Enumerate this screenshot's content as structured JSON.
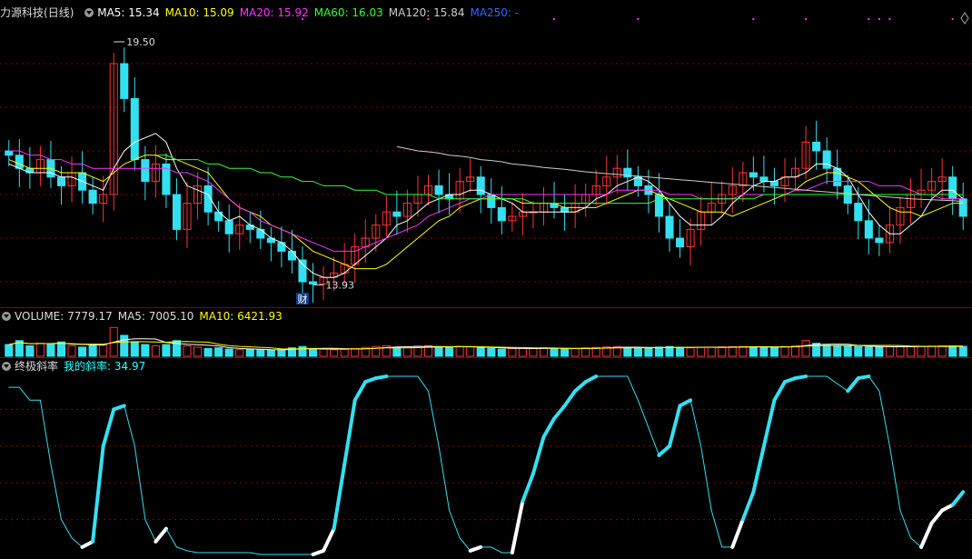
{
  "price_panel": {
    "stock_name": "力源科技",
    "period": "(日线)",
    "indicators": [
      {
        "text": "MA5: 15.34",
        "color": "#ffffff"
      },
      {
        "text": "MA10: 15.09",
        "color": "#ffff00"
      },
      {
        "text": "MA20: 15.92",
        "color": "#ff33ff"
      },
      {
        "text": "MA60: 16.03",
        "color": "#33ff33"
      },
      {
        "text": "MA120: 15.84",
        "color": "#cccccc"
      },
      {
        "text": "MA250: -",
        "color": "#3366ff"
      }
    ],
    "high_label": "19.50",
    "low_label": "13.93",
    "event_marker": "财"
  },
  "volume_panel": {
    "indicators": [
      {
        "text": "VOLUME: 7779.17",
        "color": "#dddddd"
      },
      {
        "text": "MA5: 7005.10",
        "color": "#dddddd"
      },
      {
        "text": "MA10: 6421.93",
        "color": "#ffff00"
      }
    ]
  },
  "indicator_panel": {
    "name": "终极斜率",
    "value_text": "我的斜率: 34.97",
    "value_color": "#33ffff"
  },
  "colors": {
    "up": "#ff3333",
    "down": "#33e0f0",
    "ma5": "#ffffff",
    "ma10": "#ffff00",
    "ma20": "#ff33ff",
    "ma60": "#33ff33",
    "ma120": "#cccccc",
    "grid": "#8b0000"
  },
  "chart_data": [
    {
      "type": "candlestick",
      "ylim": [
        13.5,
        20.0
      ],
      "high": 19.5,
      "low": 13.93,
      "closes": [
        16.9,
        16.6,
        16.5,
        16.8,
        16.4,
        16.2,
        16.5,
        16.1,
        15.8,
        16.0,
        19.0,
        18.2,
        16.8,
        16.3,
        16.7,
        16.0,
        15.2,
        15.8,
        16.2,
        15.6,
        15.4,
        15.1,
        15.3,
        15.2,
        15.0,
        14.9,
        14.7,
        14.5,
        14.0,
        13.95,
        14.1,
        14.2,
        14.4,
        14.8,
        15.0,
        15.3,
        15.6,
        15.5,
        15.8,
        16.0,
        16.2,
        16.0,
        15.9,
        16.3,
        16.4,
        16.0,
        15.7,
        15.4,
        15.5,
        15.6,
        15.6,
        15.8,
        15.7,
        15.6,
        15.8,
        16.0,
        16.2,
        16.4,
        16.6,
        16.4,
        16.2,
        16.0,
        15.5,
        15.0,
        14.8,
        15.2,
        15.6,
        15.8,
        16.0,
        16.2,
        16.5,
        16.4,
        16.3,
        16.2,
        16.4,
        16.6,
        17.2,
        17.0,
        16.6,
        16.2,
        15.8,
        15.4,
        15.0,
        14.9,
        15.3,
        15.7,
        16.0,
        16.1,
        16.3,
        16.4,
        15.9,
        15.5
      ],
      "series": [
        {
          "name": "MA5",
          "values": [
            16.7,
            16.6,
            16.5,
            16.5,
            16.5,
            16.4,
            16.4,
            16.3,
            16.2,
            16.1,
            16.6,
            17.0,
            17.2,
            17.3,
            17.4,
            17.2,
            16.6,
            16.2,
            16.1,
            16.0,
            15.6,
            15.4,
            15.5,
            15.3,
            15.2,
            15.0,
            14.9,
            14.7,
            14.4,
            14.2,
            14.1,
            14.1,
            14.2,
            14.4,
            14.6,
            14.8,
            15.0,
            15.3,
            15.4,
            15.6,
            15.8,
            15.9,
            16.0,
            16.0,
            16.1,
            16.1,
            16.0,
            15.9,
            15.8,
            15.6,
            15.6,
            15.6,
            15.6,
            15.6,
            15.6,
            15.7,
            15.9,
            16.0,
            16.2,
            16.3,
            16.4,
            16.3,
            16.1,
            15.8,
            15.5,
            15.3,
            15.3,
            15.3,
            15.5,
            15.8,
            16.0,
            16.2,
            16.3,
            16.3,
            16.4,
            16.4,
            16.5,
            16.7,
            16.7,
            16.6,
            16.4,
            16.0,
            15.6,
            15.3,
            15.1,
            15.1,
            15.3,
            15.5,
            15.9,
            16.1,
            16.1,
            15.9
          ]
        },
        {
          "name": "MA10",
          "values": [
            16.8,
            16.7,
            16.6,
            16.6,
            16.6,
            16.5,
            16.5,
            16.5,
            16.4,
            16.3,
            16.5,
            16.7,
            16.8,
            16.9,
            16.9,
            16.8,
            16.8,
            16.7,
            16.6,
            16.5,
            16.2,
            15.9,
            15.7,
            15.6,
            15.5,
            15.3,
            15.2,
            15.1,
            14.9,
            14.7,
            14.6,
            14.5,
            14.4,
            14.3,
            14.3,
            14.3,
            14.4,
            14.6,
            14.8,
            15.0,
            15.2,
            15.4,
            15.5,
            15.7,
            15.8,
            15.9,
            15.9,
            15.9,
            15.9,
            15.8,
            15.8,
            15.8,
            15.8,
            15.7,
            15.7,
            15.7,
            15.7,
            15.8,
            15.9,
            16.0,
            16.1,
            16.1,
            16.0,
            15.9,
            15.8,
            15.7,
            15.6,
            15.6,
            15.6,
            15.5,
            15.6,
            15.7,
            15.8,
            15.9,
            16.0,
            16.1,
            16.3,
            16.4,
            16.5,
            16.5,
            16.4,
            16.3,
            16.1,
            15.9,
            15.7,
            15.6,
            15.6,
            15.5,
            15.6,
            15.7,
            15.8,
            15.8
          ]
        },
        {
          "name": "MA20",
          "values": [
            17.0,
            17.0,
            16.9,
            16.9,
            16.8,
            16.8,
            16.7,
            16.7,
            16.6,
            16.6,
            16.6,
            16.6,
            16.6,
            16.6,
            16.6,
            16.6,
            16.5,
            16.5,
            16.4,
            16.3,
            16.1,
            15.9,
            15.7,
            15.6,
            15.4,
            15.3,
            15.2,
            15.1,
            15.0,
            14.9,
            14.8,
            14.7,
            14.7,
            14.7,
            14.8,
            14.9,
            15.0,
            15.1,
            15.2,
            15.3,
            15.5,
            15.6,
            15.7,
            15.8,
            15.9,
            15.9,
            16.0,
            16.0,
            16.0,
            16.0,
            16.0,
            16.0,
            16.0,
            16.0,
            16.0,
            16.0,
            16.0,
            16.0,
            16.1,
            16.1,
            16.1,
            16.1,
            16.1,
            16.0,
            16.0,
            16.0,
            15.9,
            15.9,
            15.9,
            15.9,
            16.0,
            16.0,
            16.0,
            16.0,
            16.0,
            16.1,
            16.1,
            16.2,
            16.3,
            16.3,
            16.3,
            16.3,
            16.3,
            16.2,
            16.2,
            16.2,
            16.1,
            16.0,
            16.0,
            15.9,
            15.9,
            15.9
          ]
        },
        {
          "name": "MA60",
          "values": [
            null,
            null,
            null,
            null,
            null,
            null,
            null,
            null,
            null,
            null,
            null,
            null,
            null,
            null,
            16.9,
            16.9,
            16.8,
            16.8,
            16.8,
            16.7,
            16.7,
            16.6,
            16.6,
            16.6,
            16.5,
            16.5,
            16.4,
            16.4,
            16.3,
            16.3,
            16.2,
            16.2,
            16.2,
            16.1,
            16.1,
            16.1,
            16.0,
            16.0,
            16.0,
            16.0,
            16.0,
            15.9,
            15.9,
            15.9,
            15.9,
            15.9,
            15.9,
            15.9,
            15.9,
            15.9,
            15.8,
            15.8,
            15.8,
            15.8,
            15.8,
            15.8,
            15.8,
            15.8,
            15.8,
            15.8,
            15.8,
            15.8,
            15.9,
            15.9,
            15.9,
            15.9,
            15.9,
            15.9,
            15.9,
            15.9,
            15.9,
            15.9,
            16.0,
            16.0,
            16.0,
            16.0,
            16.0,
            16.0,
            16.0,
            16.0,
            16.0,
            16.0,
            16.0,
            16.0,
            16.0,
            16.0,
            16.0,
            16.0,
            16.0,
            16.0,
            16.0,
            16.0
          ]
        },
        {
          "name": "MA120",
          "values": [
            null,
            null,
            null,
            null,
            null,
            null,
            null,
            null,
            null,
            null,
            null,
            null,
            null,
            null,
            null,
            null,
            null,
            null,
            null,
            null,
            null,
            null,
            null,
            null,
            null,
            null,
            null,
            null,
            null,
            null,
            null,
            null,
            null,
            null,
            null,
            null,
            null,
            17.1,
            17.05,
            17.0,
            16.98,
            16.95,
            16.9,
            16.88,
            16.85,
            16.8,
            16.78,
            16.75,
            16.7,
            16.68,
            16.65,
            16.62,
            16.6,
            16.58,
            16.55,
            16.52,
            16.5,
            16.48,
            16.46,
            16.44,
            16.42,
            16.4,
            16.38,
            16.36,
            16.34,
            16.32,
            16.3,
            16.28,
            16.26,
            16.24,
            16.22,
            16.2,
            16.18,
            16.16,
            16.14,
            16.12,
            16.1,
            16.08,
            16.06,
            16.04,
            16.02,
            16.0,
            15.98,
            15.96,
            15.94,
            15.92,
            15.9,
            15.89,
            15.88,
            15.87,
            15.86,
            15.84
          ]
        }
      ]
    },
    {
      "type": "bar",
      "name": "VOLUME",
      "ylim": [
        0,
        25000
      ],
      "values": [
        9000,
        12000,
        8000,
        10000,
        9500,
        11000,
        8000,
        7000,
        9000,
        8500,
        22000,
        16000,
        11000,
        9000,
        8000,
        9000,
        12000,
        8000,
        7000,
        6000,
        6500,
        5500,
        5000,
        5200,
        4800,
        4600,
        5000,
        6500,
        7500,
        6000,
        5500,
        5000,
        5200,
        6000,
        6800,
        7500,
        8000,
        7000,
        7200,
        7800,
        8000,
        7000,
        6800,
        7500,
        7200,
        6500,
        6000,
        5500,
        5800,
        6200,
        6000,
        6500,
        5800,
        5600,
        6000,
        6400,
        6800,
        7200,
        7500,
        6800,
        6500,
        6200,
        7000,
        7500,
        6800,
        6500,
        6800,
        7000,
        7200,
        7400,
        7500,
        7300,
        7000,
        6800,
        7500,
        8000,
        12000,
        10000,
        8500,
        8000,
        7800,
        7500,
        7200,
        7000,
        7300,
        7500,
        7600,
        7700,
        7800,
        7900,
        7779,
        7600
      ]
    },
    {
      "type": "line",
      "name": "我的斜率",
      "ylim": [
        0,
        100
      ],
      "values": [
        92,
        92,
        85,
        85,
        50,
        20,
        10,
        5,
        8,
        60,
        80,
        82,
        60,
        20,
        8,
        15,
        5,
        3,
        2,
        2,
        2,
        2,
        2,
        2,
        1,
        1,
        1,
        1,
        1,
        1,
        3,
        15,
        50,
        85,
        95,
        97,
        98,
        98,
        98,
        98,
        90,
        60,
        25,
        10,
        3,
        5,
        5,
        2,
        2,
        30,
        45,
        65,
        75,
        82,
        90,
        95,
        98,
        98,
        98,
        98,
        85,
        70,
        55,
        60,
        82,
        85,
        60,
        25,
        5,
        5,
        20,
        35,
        60,
        85,
        95,
        97,
        98,
        98,
        98,
        94,
        90,
        97,
        98,
        90,
        60,
        25,
        10,
        5,
        18,
        25,
        28,
        35
      ]
    }
  ]
}
